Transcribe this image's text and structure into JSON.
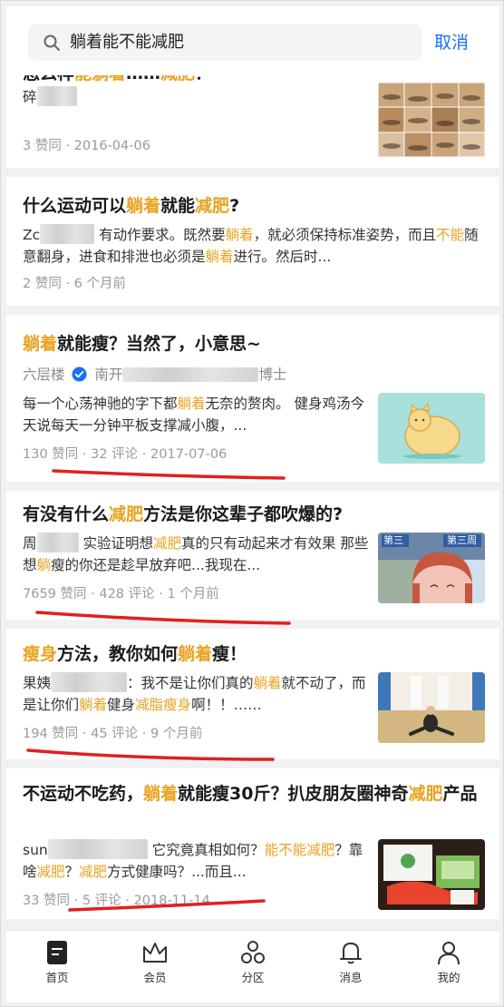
{
  "search": {
    "query": "躺着能不能减肥",
    "cancel_label": "取消",
    "icon": "search-icon"
  },
  "results": [
    {
      "title_parts": [
        "怎么样",
        "能躺着",
        "……",
        "减肥",
        "？"
      ],
      "snippet_prefix": "碎",
      "meta": "3 赞同 · 2016-04-06",
      "thumb": "exercise-grid-photo"
    },
    {
      "title_parts": [
        "什么运动可以",
        "躺着",
        "就能",
        "减肥",
        "?"
      ],
      "snippet": {
        "prefix": "Zc",
        "a": "有动作要求。既然要",
        "hl1": "躺着",
        "b": "，就必须保持标准姿势，而且",
        "hl2": "不能",
        "c": "随意翻身，进食和排泄也必须是",
        "hl3": "躺着",
        "d": "进行。然后时..."
      },
      "meta": "2 赞同 · 6 个月前"
    },
    {
      "title_parts": [
        "躺着",
        "就能瘦？当然了，小意思~"
      ],
      "author": "六层楼",
      "author_suffix_a": "南开",
      "author_suffix_b": "博士",
      "snippet": {
        "a": "每一个心荡神驰的字下都",
        "hl1": "躺着",
        "b": "无奈的赘肉。 健身鸡汤今天说每天一分钟平板支撑减小腹，..."
      },
      "meta": "130 赞同 · 32 评论 · 2017-07-06",
      "thumb": "fat-cat-illustration"
    },
    {
      "title_parts": [
        "有没有什么",
        "减肥",
        "方法是你这辈子都吹爆的?"
      ],
      "snippet": {
        "prefix": "周",
        "a": "实验证明想",
        "hl1": "减肥",
        "b": "真的只有动起来才有效果 那些想",
        "hl2": "躺",
        "c": "瘦的你还是趁早放弃吧...我现在..."
      },
      "meta": "7659 赞同 · 428 评论 · 1 个月前",
      "thumb": "before-after-photo",
      "thumb_tags": [
        "第三",
        "第三周"
      ]
    },
    {
      "title_parts": [
        "瘦身",
        "方法，教你如何",
        "躺着",
        "瘦！"
      ],
      "snippet": {
        "prefix": "果姨",
        "a": "：我不是让你们真的",
        "hl1": "躺着",
        "b": "就不动了，而是让你们",
        "hl2": "躺着",
        "c": "健身",
        "hl3": "减脂瘦身",
        "d": "啊！！……"
      },
      "meta": "194 赞同 · 45 评论 · 9 个月前",
      "thumb": "gym-floor-photo"
    },
    {
      "title_parts": [
        "不运动不吃药，",
        "躺着",
        "就能瘦30斤？扒皮朋友圈神奇",
        "减肥",
        "产品"
      ],
      "snippet": {
        "prefix": "sun",
        "a": "它究竟真相如何？",
        "hl1": "能不能减肥",
        "b": "？靠啥",
        "hl2": "减肥",
        "c": "？",
        "hl3": "减肥",
        "d": "方式健康吗？...而且..."
      },
      "meta": "33 赞同 · 5 评论 · 2018-11-14",
      "thumb": "product-box-photo"
    }
  ],
  "tabbar": {
    "items": [
      {
        "label": "首页",
        "icon": "home-icon"
      },
      {
        "label": "会员",
        "icon": "crown-icon"
      },
      {
        "label": "分区",
        "icon": "category-icon"
      },
      {
        "label": "消息",
        "icon": "bell-icon"
      },
      {
        "label": "我的",
        "icon": "profile-icon"
      }
    ]
  },
  "colors": {
    "highlight": "#e8a321",
    "accent": "#1772f6",
    "annotation": "#e0201f"
  }
}
